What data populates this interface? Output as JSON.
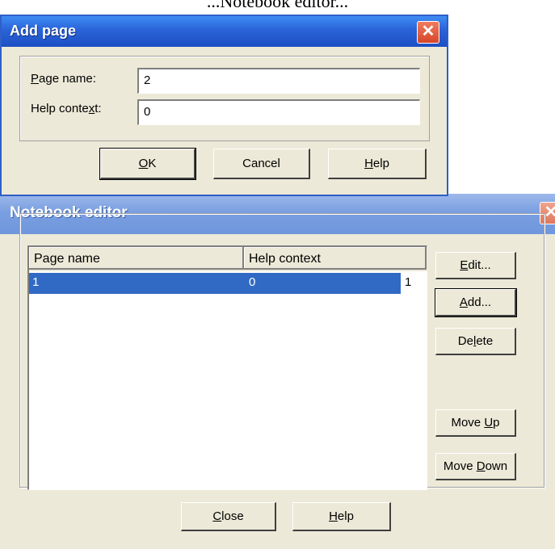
{
  "background_text": "...Notebook editor...",
  "add_page_dialog": {
    "title": "Add page",
    "close_glyph": "✕",
    "page_name_label_acc": "P",
    "page_name_label_rest": "age name:",
    "page_name_value": "2",
    "help_context_label_pre": "Help conte",
    "help_context_label_acc": "x",
    "help_context_label_post": "t:",
    "help_context_value": "0",
    "ok_acc": "O",
    "ok_rest": "K",
    "cancel_label": "Cancel",
    "help_acc": "H",
    "help_rest": "elp"
  },
  "notebook_editor": {
    "title": "Notebook editor",
    "close_glyph": "✕",
    "columns": [
      "Page name",
      "Help context"
    ],
    "rows": [
      {
        "page_name": "1",
        "help_context": "0",
        "extra": "1"
      }
    ],
    "edit_acc": "E",
    "edit_rest": "dit...",
    "add_acc": "A",
    "add_rest": "dd...",
    "delete_pre": "De",
    "delete_acc": "l",
    "delete_post": "ete",
    "move_up_pre": "Move ",
    "move_up_acc": "U",
    "move_up_post": "p",
    "move_down_pre": "Move ",
    "move_down_acc": "D",
    "move_down_post": "own",
    "close_acc": "C",
    "close_rest": "lose",
    "help_acc": "H",
    "help_rest": "elp"
  },
  "colors": {
    "dialog_face": "#ece9d8",
    "active_titlebar": "#2a63d8",
    "inactive_titlebar": "#7a9fe0",
    "selection": "#316ac5",
    "close_button": "#d4462a"
  }
}
